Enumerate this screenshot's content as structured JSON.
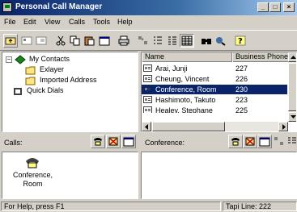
{
  "window": {
    "title": "Personal Call Manager",
    "minimize_label": "_",
    "maximize_label": "□",
    "close_label": "×"
  },
  "menu": [
    "File",
    "Edit",
    "View",
    "Calls",
    "Tools",
    "Help"
  ],
  "tree": {
    "root": "My Contacts",
    "children": [
      "Exlayer",
      "Imported Address"
    ],
    "quick_dials": "Quick Dials",
    "expander": "−"
  },
  "contacts": {
    "columns": [
      "Name",
      "Business Phone N"
    ],
    "rows": [
      {
        "name": "Arai, Junji",
        "phone": "227"
      },
      {
        "name": "Cheung, Vincent",
        "phone": "226"
      },
      {
        "name": "Conference, Room",
        "phone": "230"
      },
      {
        "name": "Hashimoto, Takuto",
        "phone": "223"
      },
      {
        "name": "Healey, Stephane",
        "phone": "225"
      }
    ],
    "selected_index": 2
  },
  "calls": {
    "label": "Calls:",
    "item_label_line1": "Conference,",
    "item_label_line2": "Room"
  },
  "conference": {
    "label": "Conference:"
  },
  "status": {
    "help": "For Help, press F1",
    "tapi": "Tapi Line: 222"
  },
  "colors": {
    "titlebar": "#0a246a",
    "selection": "#0a246a",
    "face": "#d4d0c8"
  }
}
